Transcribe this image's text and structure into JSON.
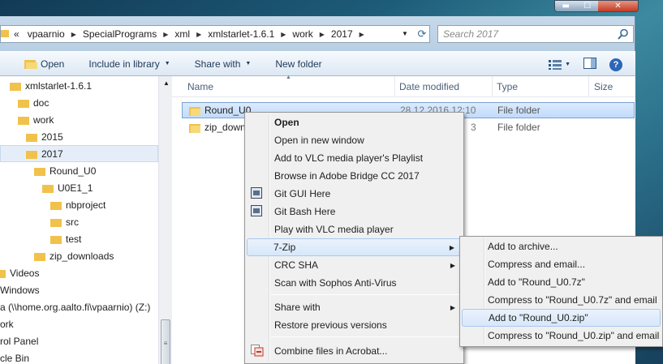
{
  "address": {
    "overflow": "«",
    "crumbs": [
      "vpaarnio",
      "SpecialPrograms",
      "xml",
      "xmlstarlet-1.6.1",
      "work",
      "2017"
    ]
  },
  "search": {
    "placeholder": "Search 2017"
  },
  "window_controls": {
    "minimize": "▬",
    "maximize": "☐",
    "close": "✕"
  },
  "toolbar": {
    "open": "Open",
    "include": "Include in library",
    "share": "Share with",
    "new_folder": "New folder",
    "help": "?"
  },
  "nav": {
    "items": [
      "xmlstarlet-1.6.1",
      "doc",
      "work",
      "2015",
      "2017",
      "Round_U0",
      "U0E1_1",
      "nbproject",
      "src",
      "test",
      "zip_downloads",
      "Videos",
      "Windows",
      "a (\\\\home.org.aalto.fi\\vpaarnio) (Z:)",
      "ork",
      "rol Panel",
      "cle Bin"
    ]
  },
  "columns": {
    "name": "Name",
    "date": "Date modified",
    "type": "Type",
    "size": "Size"
  },
  "files": [
    {
      "name": "Round_U0",
      "date": "28.12.2016 12:10",
      "type": "File folder"
    },
    {
      "name": "zip_down",
      "date": "3",
      "type": "File folder"
    }
  ],
  "context_menu": {
    "items": [
      "Open",
      "Open in new window",
      "Add to VLC media player's Playlist",
      "Browse in Adobe Bridge CC 2017",
      "Git GUI Here",
      "Git Bash Here",
      "Play with VLC media player",
      "7-Zip",
      "CRC SHA",
      "Scan with Sophos Anti-Virus",
      "Share with",
      "Restore previous versions",
      "Combine files in Acrobat..."
    ]
  },
  "zip_menu": {
    "items": [
      "Add to archive...",
      "Compress and email...",
      "Add to \"Round_U0.7z\"",
      "Compress to \"Round_U0.7z\" and email",
      "Add to \"Round_U0.zip\"",
      "Compress to \"Round_U0.zip\" and email"
    ]
  },
  "colors": {
    "folder": "#f1c24b",
    "highlight": "#cce0f8",
    "accent": "#2b66b8"
  }
}
